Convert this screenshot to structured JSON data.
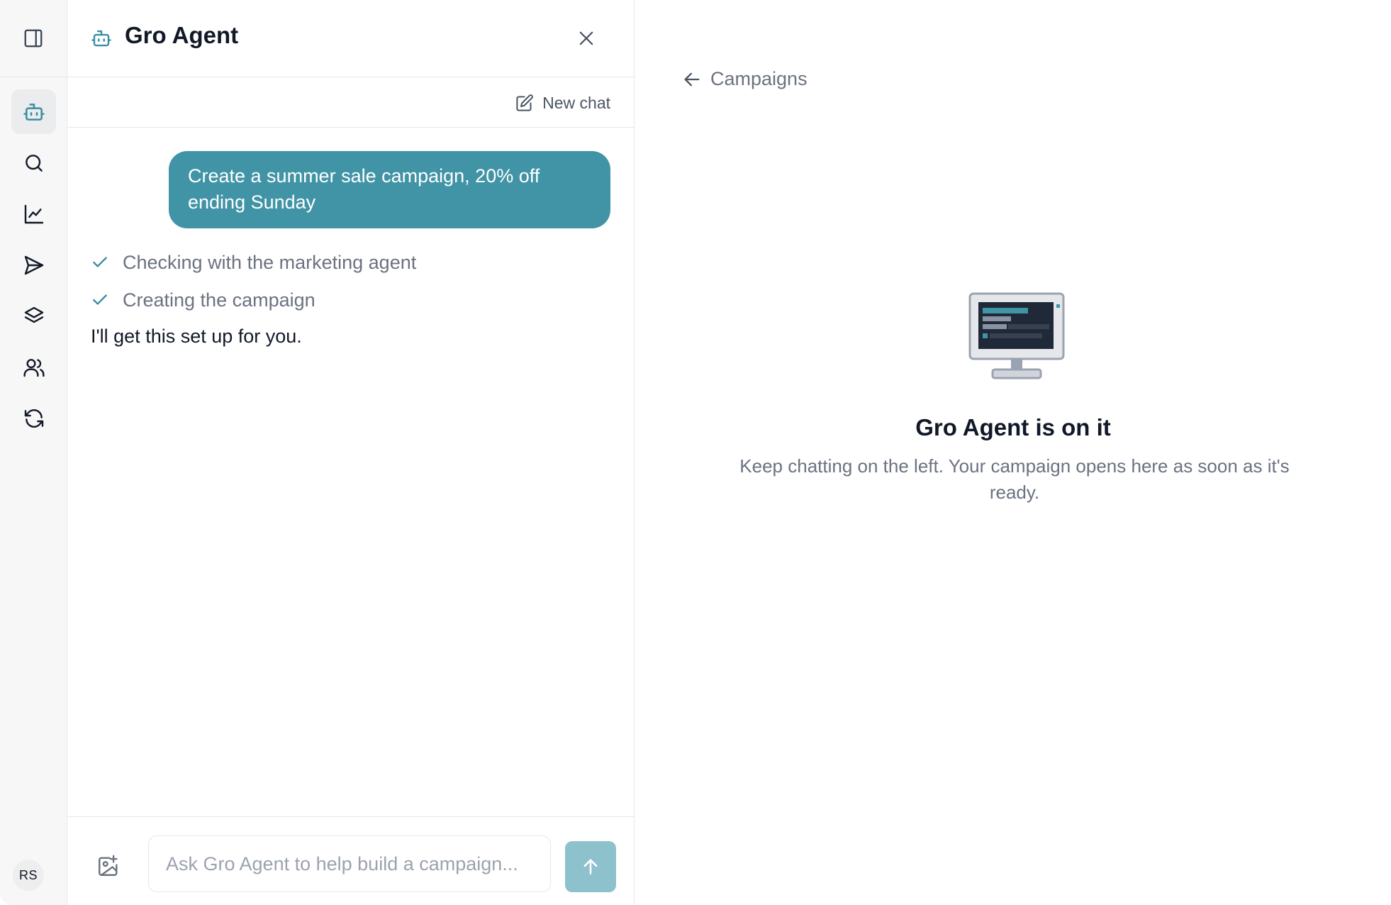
{
  "sidebar": {
    "items": [
      {
        "icon": "panel-toggle-icon"
      },
      {
        "icon": "bot-icon",
        "active": true
      },
      {
        "icon": "search-icon"
      },
      {
        "icon": "chart-line-icon"
      },
      {
        "icon": "send-icon"
      },
      {
        "icon": "layers-icon"
      },
      {
        "icon": "users-icon"
      },
      {
        "icon": "refresh-icon"
      }
    ],
    "avatar_initials": "RS"
  },
  "chat": {
    "title": "Gro Agent",
    "new_chat_label": "New chat",
    "user_message": "Create a summer sale campaign, 20% off ending Sunday",
    "steps": [
      {
        "label": "Checking with the marketing agent",
        "status": "done"
      },
      {
        "label": "Creating the campaign",
        "status": "done"
      }
    ],
    "assistant_reply": "I'll get this set up for you.",
    "input_placeholder": "Ask Gro Agent to help build a campaign..."
  },
  "main": {
    "back_label": "Campaigns",
    "empty_title": "Gro Agent is on it",
    "empty_description": "Keep chatting on the left. Your campaign opens here as soon as it's ready."
  },
  "colors": {
    "accent": "#4194a6",
    "send_button": "#8dc2cd"
  }
}
